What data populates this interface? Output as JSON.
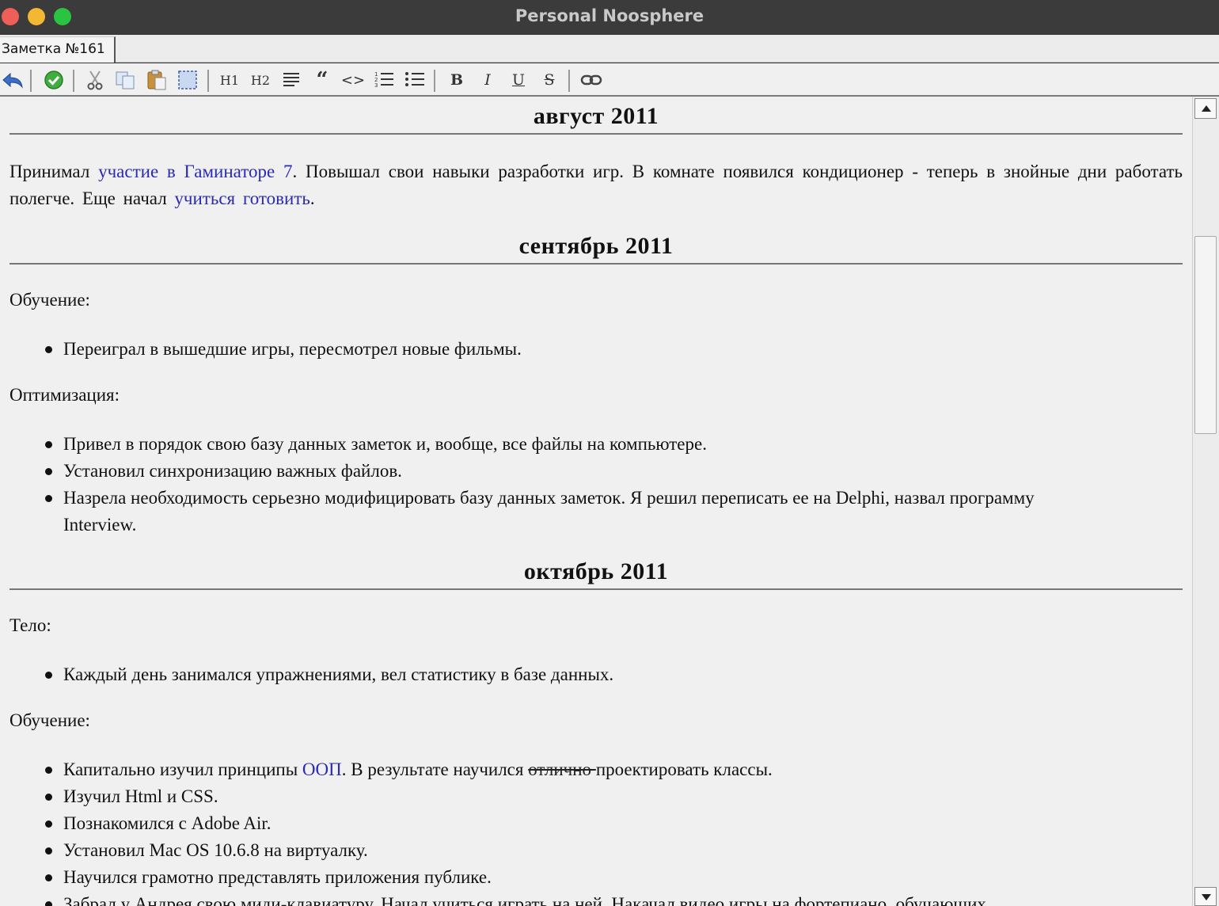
{
  "window": {
    "title": "Personal Noosphere"
  },
  "tabs": [
    {
      "label": "Заметка №161"
    }
  ],
  "toolbar": {
    "h1": "H1",
    "h2": "H2",
    "quote": "“",
    "code": "<>",
    "bold": "B",
    "italic": "I",
    "underline": "U",
    "strike": "S",
    "icons": [
      "undo-icon",
      "save-check-icon",
      "cut-icon",
      "copy-icon",
      "paste-icon",
      "select-all-icon",
      "align-justify-icon",
      "numbered-list-icon",
      "bulleted-list-icon",
      "link-icon"
    ]
  },
  "doc": {
    "august": {
      "heading": "август 2011",
      "p1_a": "Принимал ",
      "p1_link1": "участие в Гаминаторе 7",
      "p1_b": ". Повышал свои навыки разработки игр. В комнате появился кондиционер - теперь в знойные дни работать полегче. Еще начал ",
      "p1_link2": "учиться готовить",
      "p1_c": "."
    },
    "september": {
      "heading": "сентябрь 2011",
      "learning_label": "Обучение:",
      "learning_items": [
        "Переиграл в вышедшие игры, пересмотрел новые фильмы."
      ],
      "optimization_label": "Оптимизация:",
      "optimization_items": [
        "Привел в порядок свою базу данных заметок и, вообще, все файлы на компьютере.",
        "Установил синхронизацию важных файлов.",
        "Назрела необходимость серьезно модифицировать базу данных заметок. Я решил переписать ее на Delphi, назвал программу Interview."
      ]
    },
    "october": {
      "heading": "октябрь 2011",
      "body_label": "Тело:",
      "body_items": [
        "Каждый день занимался упражнениями, вел статистику в базе данных."
      ],
      "learning_label": "Обучение:",
      "oop_a": "Капитально изучил принципы ",
      "oop_link": "ООП",
      "oop_b": ". В результате научился ",
      "oop_strike": "отлично ",
      "oop_c": "проектировать классы.",
      "learning_items": [
        "Изучил Html и CSS.",
        "Познакомился с Adobe Air.",
        "Установил Mac OS 10.6.8 на виртуалку.",
        "Научился грамотно представлять приложения публике.",
        "Забрал у Андрея свою миди-клавиатуру. Начал учиться играть на ней. Накачал видео игры на фортепиано, обучающих"
      ]
    }
  },
  "colors": {
    "link": "#2a2ab4",
    "titlebar": "#3b3b3b",
    "background": "#f0f0f0"
  }
}
